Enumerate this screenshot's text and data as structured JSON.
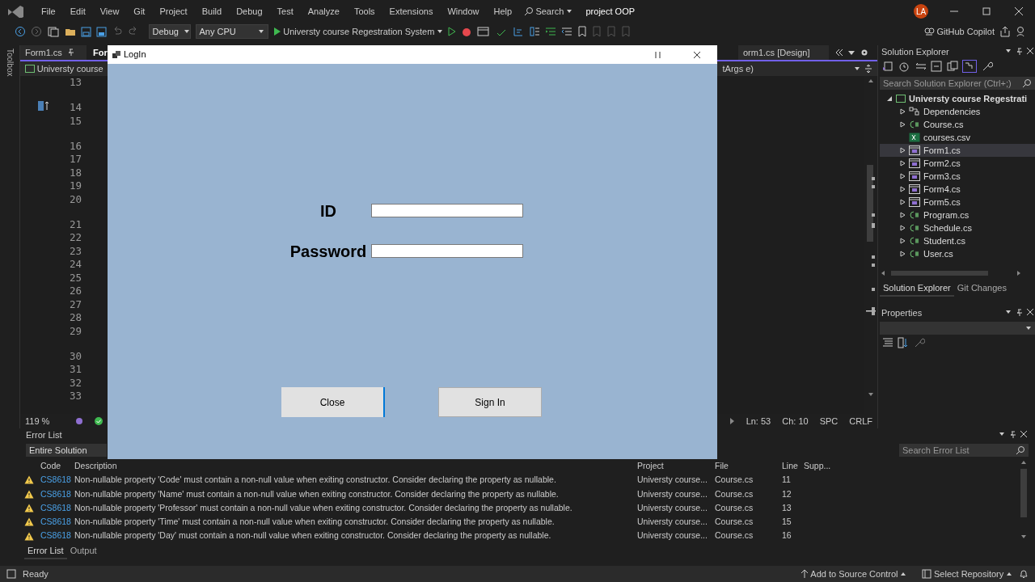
{
  "menu_bar": {
    "items": [
      "File",
      "Edit",
      "View",
      "Git",
      "Project",
      "Build",
      "Debug",
      "Test",
      "Analyze",
      "Tools",
      "Extensions",
      "Window",
      "Help"
    ],
    "search": "Search",
    "solution_name": "project OOP",
    "avatar": "LA"
  },
  "toolbar": {
    "configuration": "Debug",
    "platform": "Any CPU",
    "startup_project": "Universty course Regestration System",
    "copilot": "GitHub Copilot"
  },
  "toolbox": {
    "label": "Toolbox"
  },
  "editor": {
    "tabs": [
      {
        "label": "Form1.cs",
        "selected": false,
        "pinned": true
      },
      {
        "label": "For",
        "selected": true,
        "pinned": false
      },
      {
        "label": "orm1.cs [Design]",
        "selected": false,
        "pinned": false
      }
    ],
    "nav_left": "Universty course",
    "nav_right": "tArgs e)",
    "lines": [
      {
        "number": "13",
        "gap_before": false
      },
      {
        "number": "14",
        "gap_before": true
      },
      {
        "number": "15",
        "gap_before": false
      },
      {
        "number": "16",
        "gap_before": true
      },
      {
        "number": "17",
        "gap_before": false
      },
      {
        "number": "18",
        "gap_before": false
      },
      {
        "number": "19",
        "gap_before": false
      },
      {
        "number": "20",
        "gap_before": false
      },
      {
        "number": "21",
        "gap_before": true
      },
      {
        "number": "22",
        "gap_before": false
      },
      {
        "number": "23",
        "gap_before": false
      },
      {
        "number": "24",
        "gap_before": false
      },
      {
        "number": "25",
        "gap_before": false
      },
      {
        "number": "26",
        "gap_before": false
      },
      {
        "number": "27",
        "gap_before": false
      },
      {
        "number": "28",
        "gap_before": false
      },
      {
        "number": "29",
        "gap_before": false
      },
      {
        "number": "30",
        "gap_before": true
      },
      {
        "number": "31",
        "gap_before": false
      },
      {
        "number": "32",
        "gap_before": false
      },
      {
        "number": "33",
        "gap_before": false
      }
    ],
    "status": {
      "zoom": "119 %",
      "line": "Ln: 53",
      "column": "Ch: 10",
      "indent": "SPC",
      "line_ending": "CRLF"
    }
  },
  "login_dialog": {
    "title": "LogIn",
    "fields": [
      {
        "label": "ID"
      },
      {
        "label": "Password"
      }
    ],
    "buttons": [
      {
        "label": "Close",
        "focused": true
      },
      {
        "label": "Sign In",
        "focused": false
      }
    ]
  },
  "error_list": {
    "title": "Error List",
    "scope": "Entire Solution",
    "search_placeholder": "Search Error List",
    "columns": [
      "Code",
      "Description",
      "Project",
      "File",
      "Line",
      "Supp..."
    ],
    "rows": [
      {
        "code": "CS8618",
        "description": "Non-nullable property 'Code' must contain a non-null value when exiting constructor. Consider declaring the property as nullable.",
        "project": "Universty course...",
        "file": "Course.cs",
        "line": "11"
      },
      {
        "code": "CS8618",
        "description": "Non-nullable property 'Name' must contain a non-null value when exiting constructor. Consider declaring the property as nullable.",
        "project": "Universty course...",
        "file": "Course.cs",
        "line": "12"
      },
      {
        "code": "CS8618",
        "description": "Non-nullable property 'Professor' must contain a non-null value when exiting constructor. Consider declaring the property as nullable.",
        "project": "Universty course...",
        "file": "Course.cs",
        "line": "13"
      },
      {
        "code": "CS8618",
        "description": "Non-nullable property 'Time' must contain a non-null value when exiting constructor. Consider declaring the property as nullable.",
        "project": "Universty course...",
        "file": "Course.cs",
        "line": "15"
      },
      {
        "code": "CS8618",
        "description": "Non-nullable property 'Day' must contain a non-null value when exiting constructor. Consider declaring the property as nullable.",
        "project": "Universty course...",
        "file": "Course.cs",
        "line": "16"
      }
    ],
    "tabs": [
      {
        "label": "Error List",
        "selected": true
      },
      {
        "label": "Output",
        "selected": false
      }
    ]
  },
  "solution_explorer": {
    "title": "Solution Explorer",
    "search_placeholder": "Search Solution Explorer (Ctrl+;)",
    "root": {
      "label": "Universty course Regestrati",
      "expanded": true,
      "children": [
        {
          "label": "Dependencies",
          "kind": "dependencies",
          "expandable": true,
          "selected": false
        },
        {
          "label": "Course.cs",
          "kind": "class",
          "expandable": true,
          "selected": false
        },
        {
          "label": "courses.csv",
          "kind": "csv",
          "expandable": false,
          "selected": false
        },
        {
          "label": "Form1.cs",
          "kind": "form",
          "expandable": true,
          "selected": true
        },
        {
          "label": "Form2.cs",
          "kind": "form",
          "expandable": true,
          "selected": false
        },
        {
          "label": "Form3.cs",
          "kind": "form",
          "expandable": true,
          "selected": false
        },
        {
          "label": "Form4.cs",
          "kind": "form",
          "expandable": true,
          "selected": false
        },
        {
          "label": "Form5.cs",
          "kind": "form",
          "expandable": true,
          "selected": false
        },
        {
          "label": "Program.cs",
          "kind": "class",
          "expandable": true,
          "selected": false
        },
        {
          "label": "Schedule.cs",
          "kind": "class",
          "expandable": true,
          "selected": false
        },
        {
          "label": "Student.cs",
          "kind": "class",
          "expandable": true,
          "selected": false
        },
        {
          "label": "User.cs",
          "kind": "class",
          "expandable": true,
          "selected": false
        }
      ]
    },
    "tabs": [
      {
        "label": "Solution Explorer",
        "selected": true
      },
      {
        "label": "Git Changes",
        "selected": false
      }
    ]
  },
  "properties": {
    "title": "Properties"
  },
  "status_bar": {
    "text": "Ready",
    "source_control": "Add to Source Control",
    "repository": "Select Repository"
  }
}
